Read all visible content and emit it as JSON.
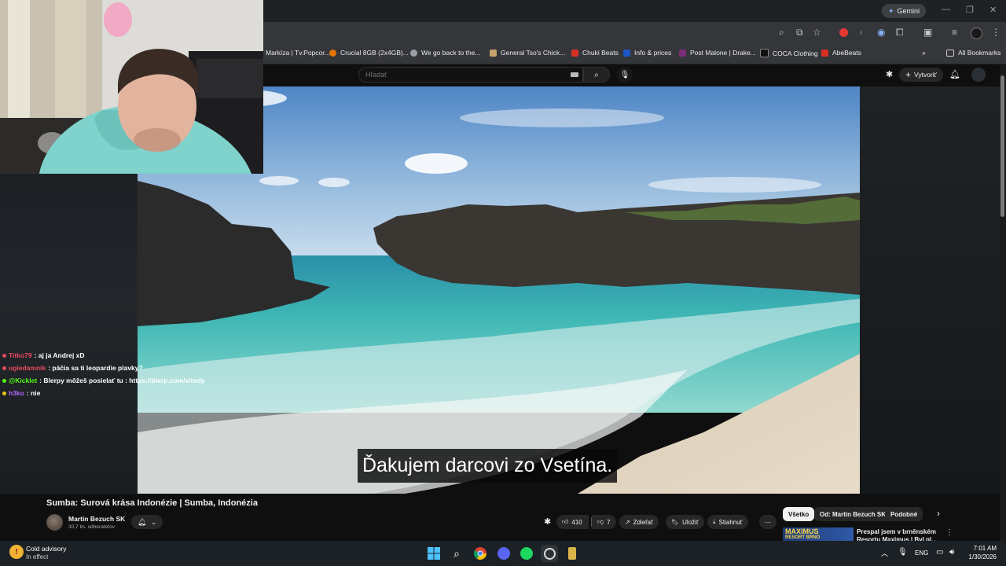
{
  "browser": {
    "gemini_label": "Gemini",
    "bookmarks": [
      {
        "label": "Markíza | Tv.Popcor...",
        "color": "#e85d75"
      },
      {
        "label": "Crucial 8GB (2x4GB)...",
        "color": "#e37400"
      },
      {
        "label": "We go back to the...",
        "color": "#9aa0a6"
      },
      {
        "label": "General Tso's Chick...",
        "color": "#c8a26b"
      },
      {
        "label": "Chuki Beats",
        "color": "#d93025"
      },
      {
        "label": "Info & prices",
        "color": "#1a56c4"
      },
      {
        "label": "Post Malone | Drake...",
        "color": "#7e2d7a"
      },
      {
        "label": "COCA Clothing",
        "color": "#111111"
      },
      {
        "label": "AbeBeats",
        "color": "#d93025"
      }
    ],
    "all_bookmarks": "All Bookmarks"
  },
  "youtube": {
    "search_placeholder": "Hľadať",
    "create_label": "Vytvoriť",
    "caption": "Ďakujem darcovi zo Vsetína.",
    "video_title": "Sumba: Surová krása Indonézie | Sumba, Indonézia",
    "channel_name": "Martin Bezuch SK",
    "subscribers": "30,7 tis. odberateľov",
    "likes": "410",
    "dislikes": "7",
    "share": "Zdieľať",
    "save": "Uložiť",
    "download": "Stiahnuť",
    "chips": [
      "Všetko",
      "Od: Martin Bezuch SK",
      "Podobné"
    ],
    "rec_title_line1": "Prespal jsem v brněnském",
    "rec_title_line2": "Resortu Maximus | Byl pl...",
    "rec_thumb_text": "MAXIMUS",
    "rec_thumb_sub": "RESORT BRNO"
  },
  "chat": [
    {
      "user": "Titko79",
      "user_color": "#e84a5f",
      "dot": "#e84a5f",
      "msg": ": aj ja Andrej xD"
    },
    {
      "user": "ugiedamnik",
      "user_color": "#e84a5f",
      "dot": "#e84a5f",
      "msg": ": páčia sa ti leopardie plavky?"
    },
    {
      "user": "@Kicklet",
      "user_color": "#53fc18",
      "dot": "#53fc18",
      "msg": ": Blerpy môžeš posielať tu : https://blerp.com/x/redy"
    },
    {
      "user": "h3ko",
      "user_color": "#b267ff",
      "dot": "#f0c419",
      "msg": ": nie"
    }
  ],
  "taskbar": {
    "weather_title": "Cold advisory",
    "weather_sub": "In effect",
    "lang": "ENG",
    "time": "7:01 AM",
    "date": "1/30/2026"
  }
}
